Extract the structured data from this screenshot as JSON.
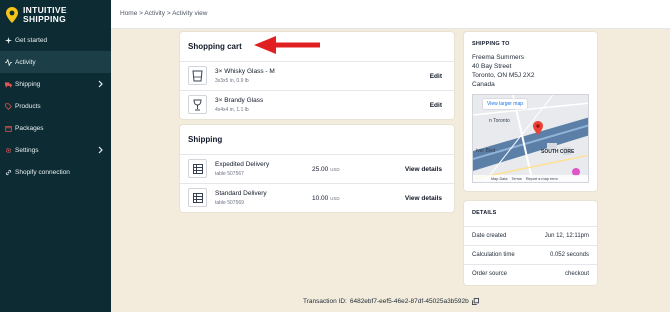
{
  "brand": {
    "line1": "INTUITIVE",
    "line2": "SHIPPING",
    "accent": "#f5c518"
  },
  "sidebar": {
    "items": [
      {
        "label": "Get started",
        "icon": "spark-icon"
      },
      {
        "label": "Activity",
        "icon": "activity-icon",
        "active": true
      },
      {
        "label": "Shipping",
        "icon": "truck-icon",
        "chevron": true
      },
      {
        "label": "Products",
        "icon": "tag-icon"
      },
      {
        "label": "Packages",
        "icon": "box-icon"
      },
      {
        "label": "Settings",
        "icon": "gear-icon",
        "chevron": true
      },
      {
        "label": "Shopify connection",
        "icon": "link-icon"
      }
    ]
  },
  "breadcrumb": {
    "home": "Home",
    "activity": "Activity",
    "current": "Activity view",
    "separator": ">"
  },
  "cart": {
    "title": "Shopping cart",
    "items": [
      {
        "name": "3× Whisky Glass - M",
        "dims": "3x3x5 in, 0.9 lb",
        "action": "Edit"
      },
      {
        "name": "3× Brandy Glass",
        "dims": "4x4x4 in, 1.1 lb",
        "action": "Edit"
      }
    ]
  },
  "shipping": {
    "title": "Shipping",
    "options": [
      {
        "name": "Expedited Delivery",
        "sub": "table 507567",
        "price": "25.00",
        "currency": "USD",
        "action": "View details"
      },
      {
        "name": "Standard Delivery",
        "sub": "table 507569",
        "price": "10.00",
        "currency": "USD",
        "action": "View details"
      }
    ]
  },
  "ship_to": {
    "title": "SHIPPING TO",
    "name": "Freema Summers",
    "street": "40 Bay Street",
    "city": "Toronto, ON M5J 2X2",
    "country": "Canada"
  },
  "map": {
    "button": "View larger map",
    "labels": {
      "toronto": "n Toronto",
      "river": "iver Blvd",
      "south_core": "SOUTH CORE"
    },
    "footer": {
      "keys": "Map Data",
      "terms": "Terms",
      "report": "Report a map error"
    },
    "pin_color": "#ea4335"
  },
  "details": {
    "title": "DETAILS",
    "rows": [
      {
        "label": "Date created",
        "value": "Jun 12, 12:11pm"
      },
      {
        "label": "Calculation time",
        "value": "0.052 seconds"
      },
      {
        "label": "Order source",
        "value": "checkout"
      }
    ]
  },
  "transaction": {
    "label": "Transaction ID:",
    "id": "6482ebf7-eef5-46e2-87df-45025a3b592b"
  },
  "colors": {
    "sidebar": "#0d2b33",
    "arrow": "#e02020",
    "background": "#f3ecdc"
  }
}
